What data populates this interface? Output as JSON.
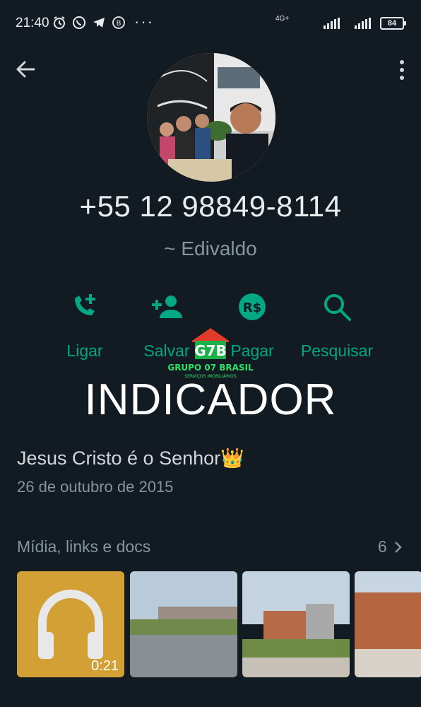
{
  "status_bar": {
    "time": "21:40",
    "network": "4G+",
    "battery": "84",
    "more": "···"
  },
  "contact": {
    "phone": "+55 12 98849-8114",
    "push_name": "~ Edivaldo"
  },
  "actions": [
    {
      "label": "Ligar",
      "icon": "call-add-icon"
    },
    {
      "label": "Salvar",
      "icon": "add-contact-icon"
    },
    {
      "label": "Pagar",
      "icon": "brl-currency-icon"
    },
    {
      "label": "Pesquisar",
      "icon": "search-icon"
    }
  ],
  "about": {
    "text": "Jesus Cristo é o Senhor👑",
    "date": "26 de outubro de 2015"
  },
  "media": {
    "title": "Mídia, links e docs",
    "count": "6",
    "audio_duration": "0:21"
  },
  "watermark": {
    "brand": "GRUPO 07 BRASIL",
    "sub": "SERVIÇOS IMOBILIÁRIOS",
    "caption": "INDICADOR"
  },
  "colors": {
    "background": "#121b22",
    "accent": "#00a884",
    "muted": "#8696a0"
  }
}
